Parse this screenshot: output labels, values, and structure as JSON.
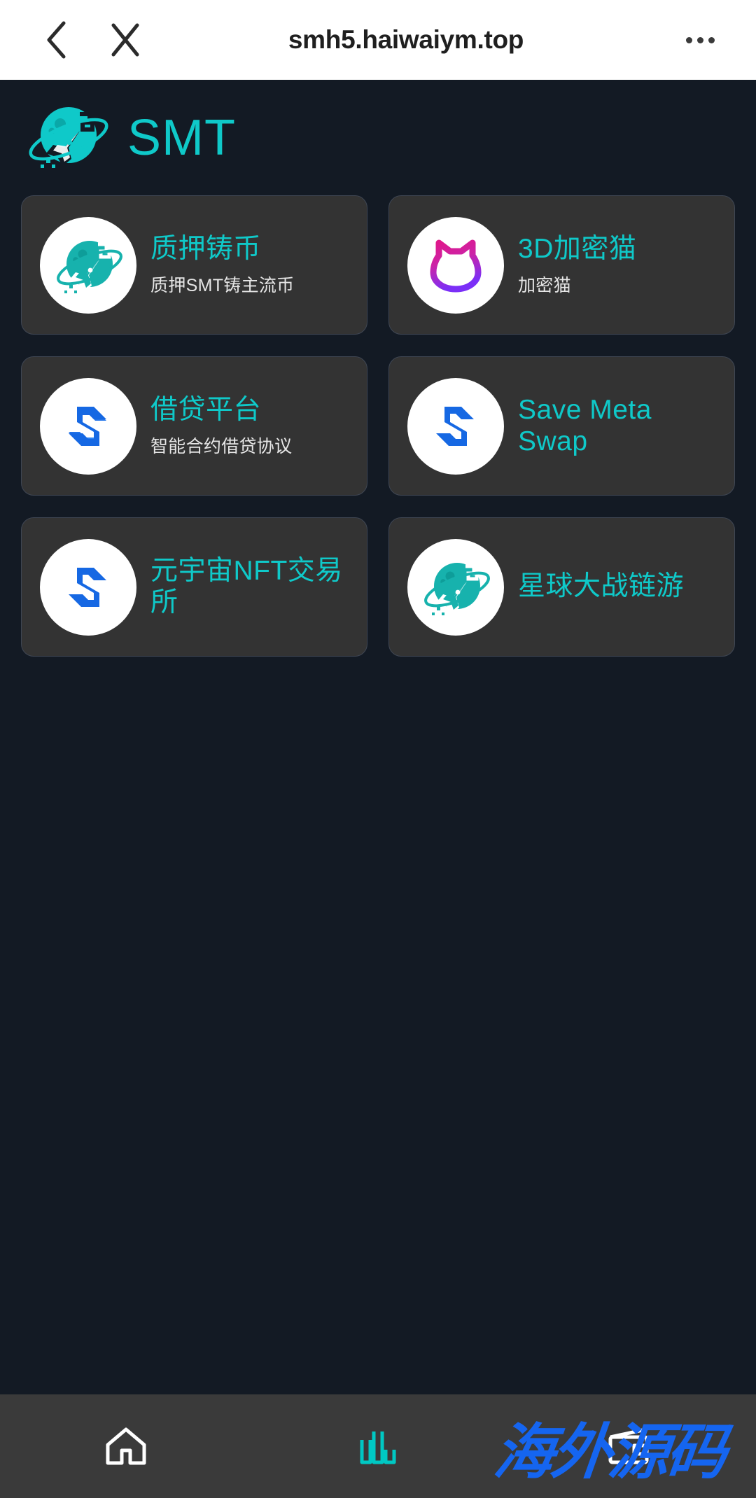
{
  "browser": {
    "url_title": "smh5.haiwaiym.top",
    "back_icon": "chevron-left-icon",
    "close_icon": "close-icon",
    "menu_icon": "more-horizontal-icon"
  },
  "brand": {
    "name": "SMT",
    "logo_icon": "planet-rocket-icon"
  },
  "colors": {
    "page_background": "#131a24",
    "card_background": "#333333",
    "card_border": "#3f4653",
    "accent_teal": "#0fc9c9",
    "subtitle": "#e6e6e6",
    "nav_background": "#3a3a3a",
    "nav_active": "#00c8c3",
    "nav_inactive": "#ffffff",
    "watermark": "#1565f0",
    "logo_blue": "#1668e3",
    "cat_pink": "#e0218a",
    "cat_purple": "#7b2ff7"
  },
  "cards": [
    {
      "title": "质押铸币",
      "subtitle": "质押SMT铸主流币",
      "icon": "planet-rocket-icon"
    },
    {
      "title": "3D加密猫",
      "subtitle": "加密猫",
      "icon": "crypto-cat-icon"
    },
    {
      "title": "借贷平台",
      "subtitle": "智能合约借贷协议",
      "icon": "s-hexagon-icon"
    },
    {
      "title": "Save Meta Swap",
      "subtitle": "",
      "icon": "s-hexagon-icon"
    },
    {
      "title": "元宇宙NFT交易所",
      "subtitle": "",
      "icon": "s-hexagon-icon"
    },
    {
      "title": "星球大战链游",
      "subtitle": "",
      "icon": "planet-rocket-icon"
    }
  ],
  "bottom_nav": [
    {
      "icon": "home-icon",
      "active": false
    },
    {
      "icon": "bar-chart-icon",
      "active": true
    },
    {
      "icon": "wallet-icon",
      "active": false
    }
  ],
  "watermark": {
    "text": "海外源码"
  }
}
